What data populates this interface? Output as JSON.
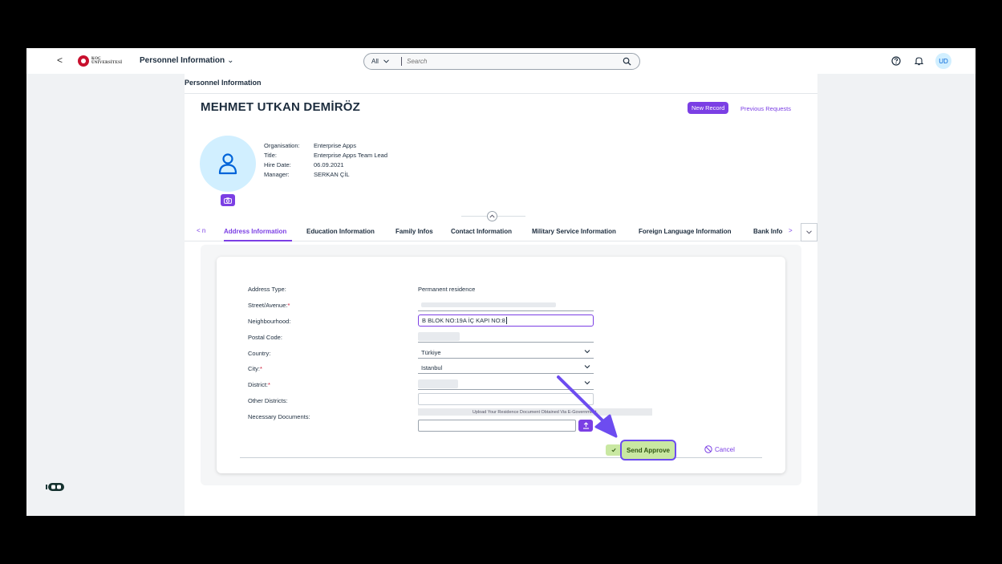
{
  "shell": {
    "back_label": "<",
    "logo_text_line1": "KOÇ",
    "logo_text_line2": "ÜNİVERSİTESİ",
    "app_title": "Personnel Information",
    "search_scope": "All",
    "search_placeholder": "Search",
    "avatar_initials": "UD"
  },
  "page": {
    "title": "Personnel Information",
    "employee_name": "MEHMET UTKAN DEMİRÖZ",
    "new_record_label": "New Record",
    "previous_requests_label": "Previous Requests",
    "attributes": [
      {
        "label": "Organisation:",
        "value": "Enterprise Apps"
      },
      {
        "label": "Title:",
        "value": "Enterprise Apps Team Lead"
      },
      {
        "label": "Hire Date:",
        "value": "06.09.2021"
      },
      {
        "label": "Manager:",
        "value": "SERKAN ÇİL"
      }
    ]
  },
  "tabs": {
    "left_nav": "< n",
    "items": [
      {
        "label": "Address Information",
        "active": true
      },
      {
        "label": "Education Information",
        "active": false
      },
      {
        "label": "Family Infos",
        "active": false
      },
      {
        "label": "Contact Information",
        "active": false
      },
      {
        "label": "Military Service Information",
        "active": false
      },
      {
        "label": "Foreign Language Information",
        "active": false
      },
      {
        "label": "Bank Info",
        "active": false
      }
    ],
    "right_nav": ">"
  },
  "form": {
    "address_type_label": "Address Type:",
    "address_type_value": "Permanent residence",
    "street_label": "Street/Avenue:",
    "neighbourhood_label": "Neighbourhood:",
    "neighbourhood_value": "B BLOK NO:19A İÇ KAPI NO:8",
    "postal_code_label": "Postal Code:",
    "country_label": "Country:",
    "country_value": "Türkiye",
    "city_label": "City:",
    "city_value": "Istanbul",
    "district_label": "District:",
    "other_districts_label": "Other Districts:",
    "documents_label": "Necessary Documents:",
    "upload_hint": "Upload Your Residence Document Obtained Via E-Government.",
    "required_mark": "*",
    "send_label": "Send Approve",
    "cancel_label": "Cancel"
  },
  "colors": {
    "accent": "#7b3fe4",
    "send_bg": "#c9e8a2",
    "required": "#c8102e",
    "annotation_arrow": "#6d4cf0"
  }
}
